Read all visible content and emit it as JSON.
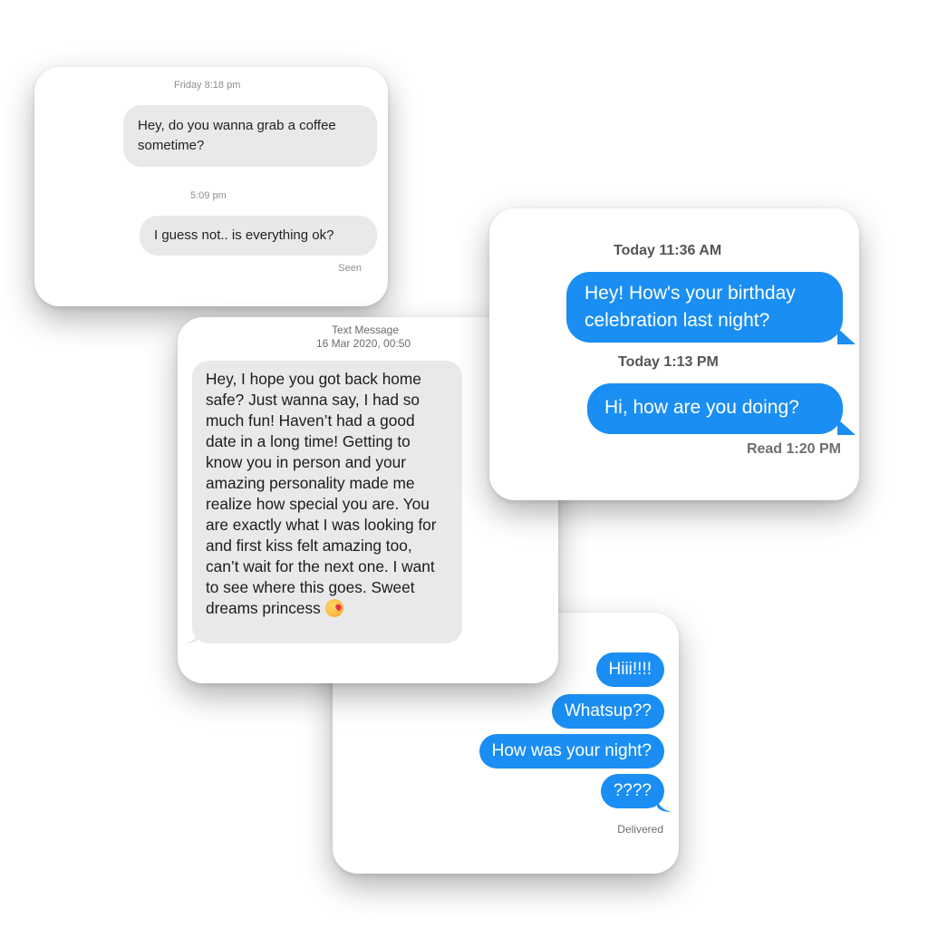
{
  "card1": {
    "timestamp1": "Friday 8:18 pm",
    "message1": "Hey, do you wanna grab a coffee sometime?",
    "timestamp2": "5:09 pm",
    "message2": "I guess not.. is everything ok?",
    "status": "Seen"
  },
  "card2": {
    "timestamp1": "Today 11:36 AM",
    "message1": "Hey! How's your birthday celebration last night?",
    "timestamp2": "Today 1:13 PM",
    "message2": "Hi, how are you doing?",
    "status": "Read 1:20 PM",
    "bubble_color": "#1a8ef2"
  },
  "card3": {
    "header_line1": "Text Message",
    "header_line2": "16 Mar 2020, 00:50",
    "message": "Hey, I hope you got back home safe? Just wanna say, I had so much fun! Haven’t had a good date in a long time! Getting to know you in person and your amazing personality made me realize how special you are. You are exactly what I was looking for and first kiss felt amazing too, can’t wait for the next one. I want to see where this goes. Sweet dreams princess",
    "emoji": "kissing-face-emoji"
  },
  "card4": {
    "messages": [
      "Hiii!!!!",
      "Whatsup??",
      "How was your night?",
      "????"
    ],
    "status": "Delivered",
    "bubble_color": "#1a8ef2"
  }
}
